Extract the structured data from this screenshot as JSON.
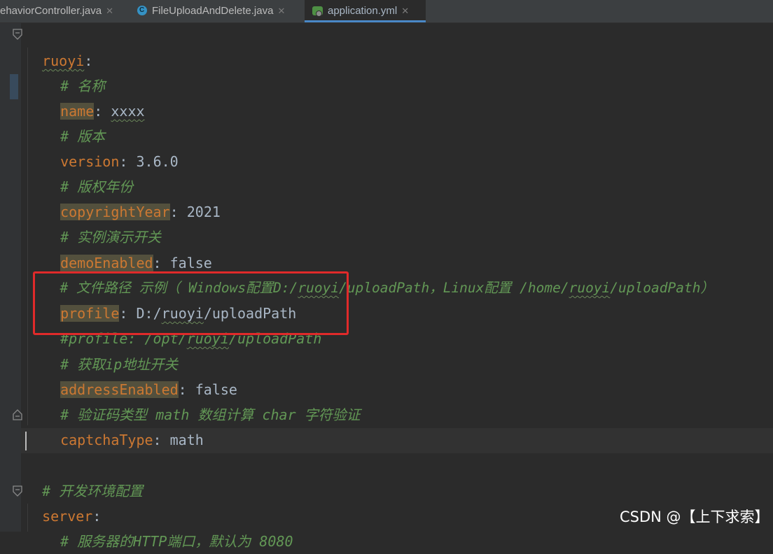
{
  "tabs": [
    {
      "label": "ehaviorController.java",
      "icon": "java-class-icon",
      "active": false
    },
    {
      "label": "FileUploadAndDelete.java",
      "icon": "java-class-icon",
      "active": false
    },
    {
      "label": "application.yml",
      "icon": "yaml-file-icon",
      "active": true
    }
  ],
  "editor": {
    "lines": [
      {
        "key": "ruoyi",
        "sep": ":"
      },
      {
        "comment": "# 名称"
      },
      {
        "key": "name",
        "sep": ": ",
        "value": "xxxx"
      },
      {
        "comment": "# 版本"
      },
      {
        "key": "version",
        "sep": ": ",
        "value": "3.6.0"
      },
      {
        "comment": "# 版权年份"
      },
      {
        "key": "copyrightYear",
        "sep": ": ",
        "value": "2021"
      },
      {
        "comment": "# 实例演示开关"
      },
      {
        "key": "demoEnabled",
        "sep": ": ",
        "value": "false"
      },
      {
        "comment_a": "# 文件路径 示例（ Windows配置D:/",
        "comment_b": "ruoyi",
        "comment_c": "/uploadPath，Linux配置 /home/",
        "comment_d": "ruoyi",
        "comment_e": "/uploadPath）"
      },
      {
        "key": "profile",
        "sep": ": ",
        "value_a": "D:/",
        "value_b": "ruoyi",
        "value_c": "/uploadPath"
      },
      {
        "comment_a": "#profile: /opt/",
        "comment_b": "ruoyi",
        "comment_c": "/uploadPath"
      },
      {
        "comment": "# 获取ip地址开关"
      },
      {
        "key": "addressEnabled",
        "sep": ": ",
        "value": "false"
      },
      {
        "comment": "# 验证码类型 math 数组计算 char 字符验证"
      },
      {
        "key": "captchaType",
        "sep": ": ",
        "value": "math"
      },
      {
        "empty": ""
      },
      {
        "comment": "# 开发环境配置"
      },
      {
        "key": "server",
        "sep": ":"
      },
      {
        "comment": "# 服务器的HTTP端口，默认为 8080"
      }
    ]
  },
  "watermark": "CSDN @【上下求索】",
  "colors": {
    "key": "#cc7832",
    "comment": "#629755",
    "value": "#a9b7c6",
    "highlight_box": "#e02a2a",
    "background": "#2b2b2b"
  }
}
